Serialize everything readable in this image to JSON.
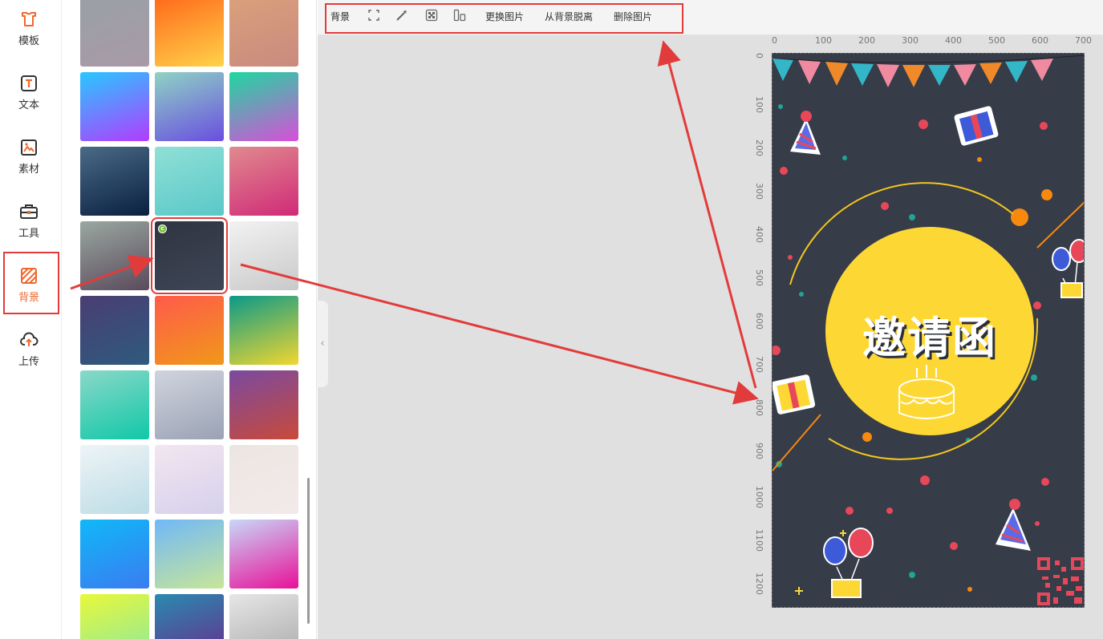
{
  "nav": {
    "items": [
      {
        "label": "模板",
        "icon": "template-icon"
      },
      {
        "label": "文本",
        "icon": "text-icon"
      },
      {
        "label": "素材",
        "icon": "image-icon"
      },
      {
        "label": "工具",
        "icon": "toolbox-icon"
      },
      {
        "label": "背景",
        "icon": "background-icon",
        "active": true
      },
      {
        "label": "上传",
        "icon": "upload-icon"
      }
    ]
  },
  "toolbar": {
    "section_label": "背景",
    "replace_label": "更换图片",
    "detach_label": "从背景脱离",
    "delete_label": "删除图片",
    "icons": [
      "fullscreen-icon",
      "magic-wand-icon",
      "mosaic-icon",
      "flip-icon"
    ]
  },
  "swatches": [
    [
      "#9aa0a6,#a89aa6",
      "#ff6a1a,#ffd24a",
      "#d9a07c,#c98a7e"
    ],
    [
      "#28c8ff,#b23cff",
      "#8fd3c4,#6a4ee0",
      "#1ed8a0,#d84fd8"
    ],
    [
      "#4a6a88,#0a2040",
      "#8fe0d6,#5ac8c8",
      "#e08a8e,#d02a78"
    ],
    [
      "#9aa8a0,#5a4a5c",
      "#2f3440,#3e4656",
      "#f2f2f2,#c9c9c9"
    ],
    [
      "#4a3e72,#2e5a7e",
      "#ff5a4a,#f0981a",
      "#0a9a88,#f2d630"
    ],
    [
      "#8ad8c8,#10c8a8",
      "#d0d4de,#9aa2b4",
      "#7a4aa0,#c84a3a"
    ],
    [
      "#eef4f6,#bcdce6",
      "#f2e6f0,#d6d0ec",
      "#ece6e2,#f2eaea"
    ],
    [
      "#10b8f8,#3a7cf0",
      "#70b8f8,#c8e698",
      "#c8d8f8,#e8109a"
    ],
    [
      "#e8f83a,#8ae8a0",
      "#2a8ab0,#6a2a8a",
      "#e6e6e6,#a8a8a8"
    ]
  ],
  "canvas": {
    "title": "邀请函",
    "ruler_top": [
      "0",
      "100",
      "200",
      "300",
      "400",
      "500",
      "600",
      "700"
    ],
    "ruler_left": [
      "0",
      "100",
      "200",
      "300",
      "400",
      "500",
      "600",
      "700",
      "800",
      "900",
      "1000",
      "1100",
      "1200"
    ],
    "accent": "#fdd835",
    "background": "#363c48"
  },
  "annotations": {
    "highlight_color": "#e23b3b"
  }
}
